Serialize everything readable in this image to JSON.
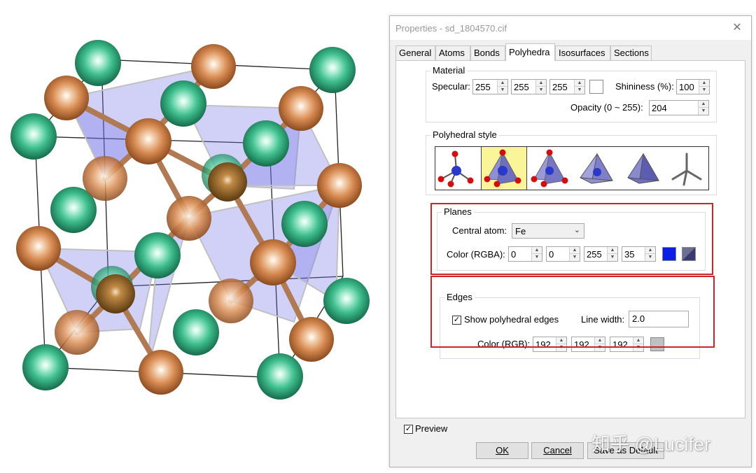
{
  "dialog": {
    "title": "Properties - sd_1804570.cif",
    "close_glyph": "✕",
    "tabs": [
      {
        "label": "General",
        "active": false
      },
      {
        "label": "Atoms",
        "active": false
      },
      {
        "label": "Bonds",
        "active": false
      },
      {
        "label": "Polyhedra",
        "active": true
      },
      {
        "label": "Isosurfaces",
        "active": false
      },
      {
        "label": "Sections",
        "active": false
      }
    ]
  },
  "material": {
    "legend": "Material",
    "specular_label": "Specular:",
    "specular_values": [
      "255",
      "255",
      "255"
    ],
    "specular_color": "#ffffff",
    "shininess_label": "Shininess (%):",
    "shininess_value": "100",
    "opacity_label": "Opacity (0 ~ 255):",
    "opacity_value": "204"
  },
  "polyhedral_style": {
    "legend": "Polyhedral style",
    "selected_index": 1,
    "icons": [
      "ball-and-stick-style-icon",
      "polyhedra-with-atoms-style-icon",
      "polyhedra-with-bonds-style-icon",
      "transparent-polyhedra-style-icon",
      "solid-polyhedra-style-icon",
      "stick-style-icon"
    ]
  },
  "planes": {
    "legend": "Planes",
    "central_atom_label": "Central atom:",
    "central_atom_value": "Fe",
    "color_label": "Color (RGBA):",
    "rgba_values": [
      "0",
      "0",
      "255",
      "35"
    ],
    "color_swatch": "#0a1ee6"
  },
  "edges": {
    "legend": "Edges",
    "show_edges_label": "Show polyhedral edges",
    "show_edges_checked": true,
    "line_width_label": "Line width:",
    "line_width_value": "2.0",
    "color_label": "Color (RGB):",
    "rgb_values": [
      "192",
      "192",
      "192"
    ],
    "color_swatch": "#c0c0c0"
  },
  "footer": {
    "preview_label": "Preview",
    "preview_checked": true,
    "ok_label": "OK",
    "cancel_label": "Cancel",
    "default_label": "Save as Default"
  },
  "watermark": "知乎 @Lucifer",
  "colors": {
    "highlight_border": "#c9252b",
    "style_selected_bg": "#fbf59a"
  }
}
